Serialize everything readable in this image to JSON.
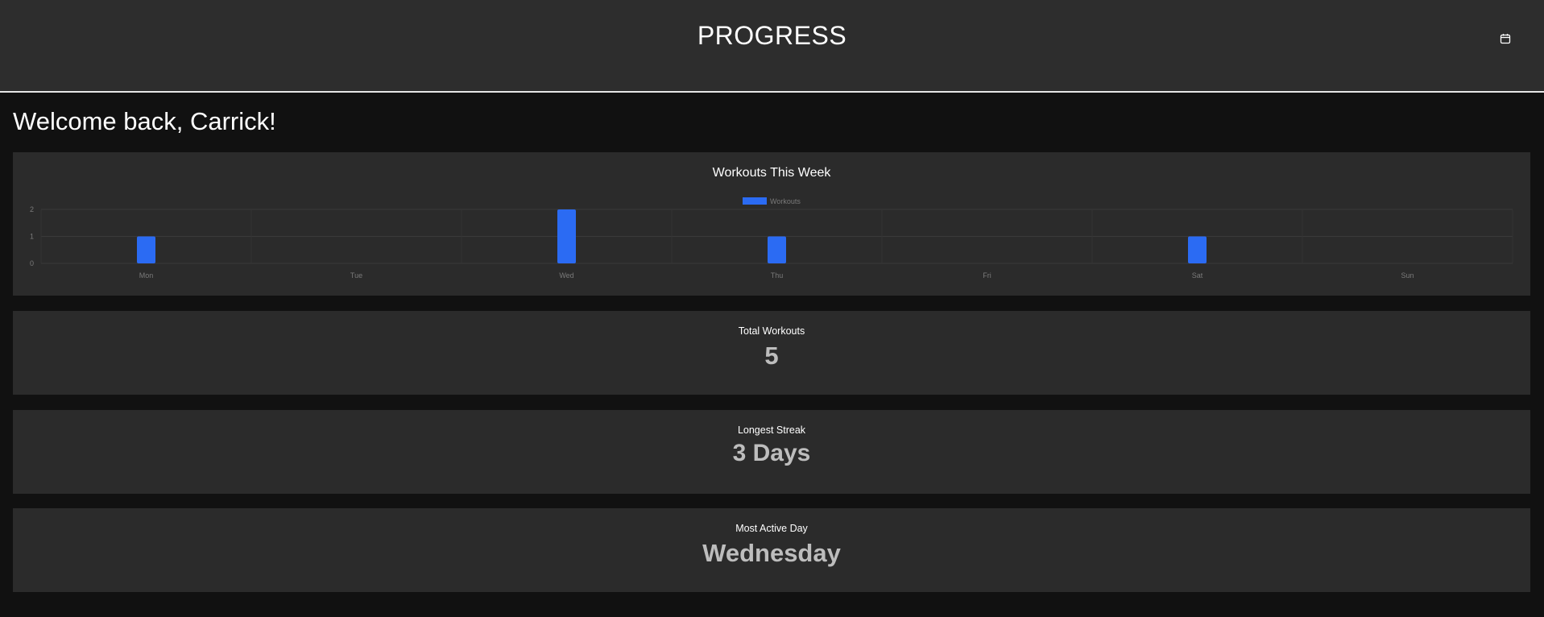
{
  "header": {
    "title": "PROGRESS",
    "calendar_icon": "calendar-icon"
  },
  "welcome": "Welcome back, Carrick!",
  "chart_data": {
    "type": "bar",
    "title": "Workouts This Week",
    "categories": [
      "Mon",
      "Tue",
      "Wed",
      "Thu",
      "Fri",
      "Sat",
      "Sun"
    ],
    "series": [
      {
        "name": "Workouts",
        "values": [
          1,
          0,
          2,
          1,
          0,
          1,
          0
        ]
      }
    ],
    "ylim": [
      0,
      2
    ],
    "yticks": [
      "0",
      "1",
      "2"
    ],
    "legend": "top-center",
    "grid": true,
    "bar_color": "#2b6bf3"
  },
  "stats": [
    {
      "label": "Total Workouts",
      "value": "5"
    },
    {
      "label": "Longest Streak",
      "value": "3 Days"
    },
    {
      "label": "Most Active Day",
      "value": "Wednesday"
    }
  ],
  "colors": {
    "background": "#111111",
    "header": "#2d2d2d",
    "card": "#2b2b2b",
    "accent": "#2b6bf3",
    "stat_value": "#bdbdbd"
  }
}
